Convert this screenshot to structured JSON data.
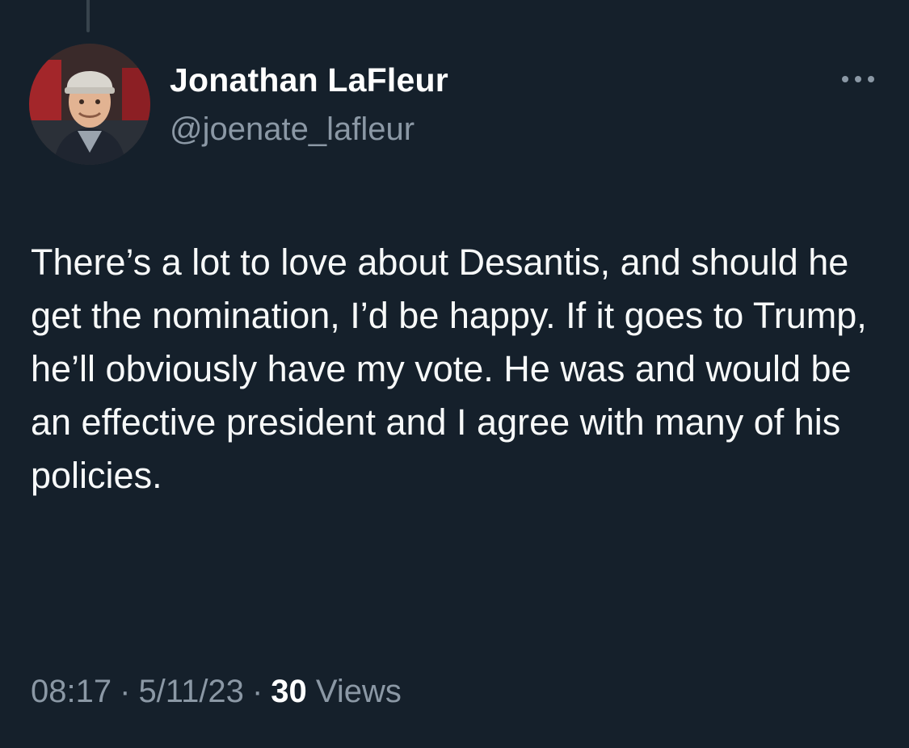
{
  "author": {
    "display_name": "Jonathan LaFleur",
    "handle": "@joenate_lafleur",
    "avatar_icon": "profile-photo"
  },
  "more_icon": "more-horizontal-icon",
  "tweet": {
    "text": "There’s a lot to love about Desantis, and should he get the nomination, I’d be happy. If it goes to Trump, he’ll obviously have my vote. He was and would be an effective president and I agree with many of his policies."
  },
  "meta": {
    "time": "08:17",
    "date": "5/11/23",
    "separator": "·",
    "views_count": "30",
    "views_label": "Views"
  },
  "colors": {
    "background": "#15202b",
    "primary_text": "#e7e9ea",
    "secondary_text": "#8b98a5",
    "thread_line": "#38444d"
  }
}
